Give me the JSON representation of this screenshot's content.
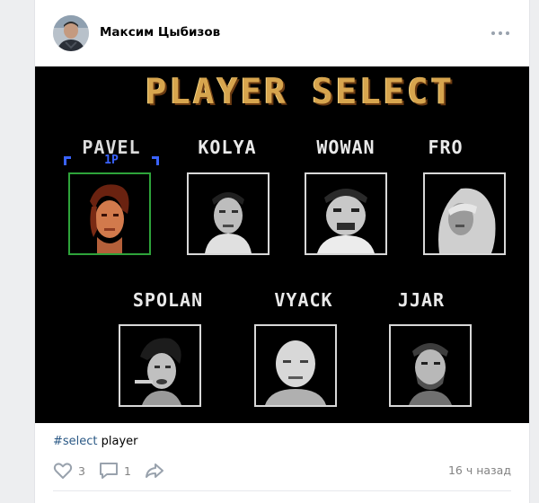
{
  "post": {
    "author": "Максим Цыбизов",
    "caption_tag": "#select",
    "caption_text": " player",
    "likes": "3",
    "comments": "1",
    "time": "16 ч назад"
  },
  "game": {
    "title": "PLAYER SELECT",
    "p1_label": "1P",
    "players_row1": [
      "PAVEL",
      "KOLYA",
      "WOWAN",
      "FRO"
    ],
    "players_row2": [
      "SPOLAN",
      "VYACK",
      "JJAR"
    ],
    "selected": "PAVEL"
  },
  "colors": {
    "link": "#2a5885",
    "muted": "#828282",
    "select_frame": "#2ea33a",
    "p1_tag": "#3a63ff",
    "title_gold": "#d7a54e"
  },
  "icons": [
    "more-dots-icon",
    "heart-icon",
    "comment-icon",
    "share-icon"
  ]
}
